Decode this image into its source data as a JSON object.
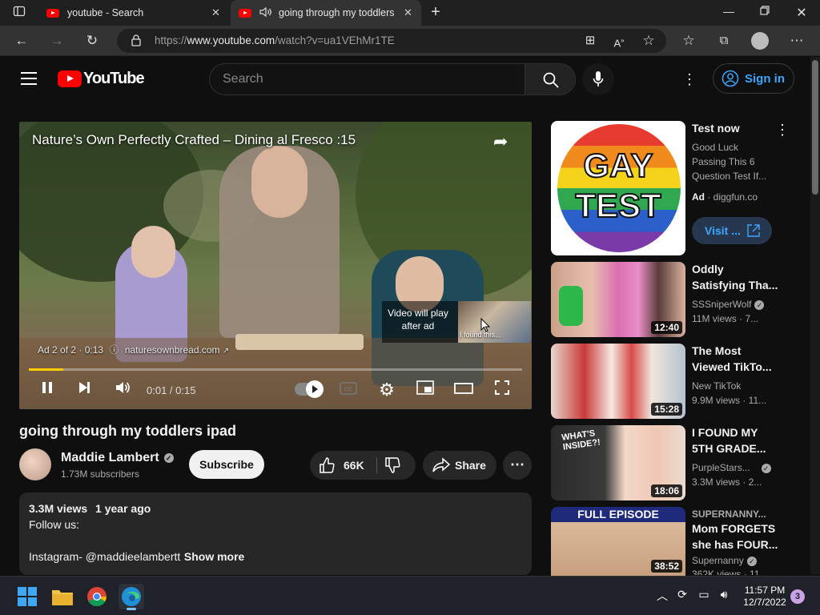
{
  "browser": {
    "tabs": [
      {
        "title": "youtube - Search",
        "active": false
      },
      {
        "title": "going through my toddlers",
        "active": true
      }
    ],
    "url_prefix": "https://",
    "url_domain": "www.youtube.com",
    "url_path": "/watch?v=ua1VEhMr1TE"
  },
  "youtube_header": {
    "logo_text": "YouTube",
    "search_placeholder": "Search",
    "signin_label": "Sign in"
  },
  "player": {
    "ad_title": "Nature’s Own Perfectly Crafted – Dining al Fresco :15",
    "will_play_text": "Video will play after ad",
    "will_play_thumb_label": "I found this...",
    "ad_counter": "Ad 2 of 2 · 0:13",
    "ad_domain": "naturesownbread.com",
    "time": "0:01 / 0:15",
    "progress_fraction": 0.07
  },
  "video": {
    "title": "going through my toddlers ipad",
    "channel_name": "Maddie Lambert",
    "subscribers": "1.73M subscribers",
    "subscribe_label": "Subscribe",
    "likes": "66K",
    "share_label": "Share",
    "views": "3.3M views",
    "age": "1 year ago",
    "desc_line1": "Follow us:",
    "desc_line2": "Instagram- @maddieelambertt",
    "show_more": "Show more"
  },
  "sidebar": {
    "ad": {
      "thumb_text_1": "GAY",
      "thumb_text_2": "TEST",
      "title": "Test now",
      "desc_1": "Good Luck",
      "desc_2": "Passing This 6",
      "desc_3": "Question Test If...",
      "ad_label": "Ad",
      "advertiser": "diggfun.co",
      "visit_label": "Visit ..."
    },
    "videos": [
      {
        "title_1": "Oddly",
        "title_2": "Satisfying Tha...",
        "channel": "SSSniperWolf",
        "verified": true,
        "meta": "11M views · 7...",
        "duration": "12:40"
      },
      {
        "title_1": "The Most",
        "title_2": "Viewed TikTo...",
        "channel": "New TikTok",
        "verified": false,
        "meta": "9.9M views · 11...",
        "duration": "15:28"
      },
      {
        "title_1": "I FOUND MY",
        "title_2": "5TH GRADE...",
        "channel": "PurpleStars...",
        "verified": true,
        "meta": "3.3M views · 2...",
        "duration": "18:06",
        "thumb_text": "WHAT'S INSIDE?!"
      },
      {
        "title_0": "SUPERNANNY...",
        "title_1": "Mom FORGETS",
        "title_2": "she has FOUR...",
        "channel": "Supernanny",
        "verified": true,
        "meta": "362K views · 11...",
        "duration": "38:52",
        "thumb_text": "FULL EPISODE"
      }
    ]
  },
  "taskbar": {
    "time": "11:57 PM",
    "date": "12/7/2022",
    "notifications": "3"
  },
  "colors": {
    "youtube_red": "#ff0000",
    "link_blue": "#3ea6ff",
    "ad_progress": "#ffcc00",
    "background": "#0f0f0f"
  }
}
